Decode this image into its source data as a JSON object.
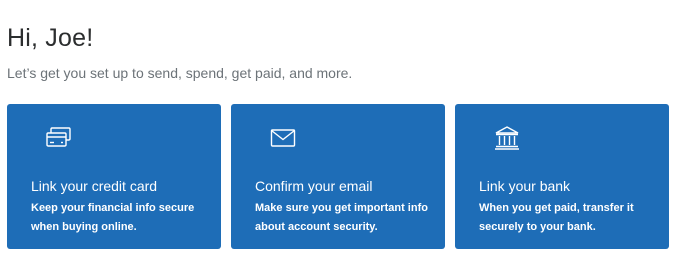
{
  "header": {
    "greeting": "Hi, Joe!",
    "subtitle": "Let’s get you set up to send, spend, get paid, and more."
  },
  "cards": [
    {
      "icon": "credit-card-icon",
      "title": "Link your credit card",
      "description": "Keep your financial info secure when buying online."
    },
    {
      "icon": "envelope-icon",
      "title": "Confirm your email",
      "description": "Make sure you get important info about account security."
    },
    {
      "icon": "bank-icon",
      "title": "Link your bank",
      "description": "When you get paid, transfer it securely to your bank."
    }
  ],
  "colors": {
    "card_background": "#1e6db7",
    "greeting_text": "#2c2e2f",
    "subtitle_text": "#6c7378"
  }
}
